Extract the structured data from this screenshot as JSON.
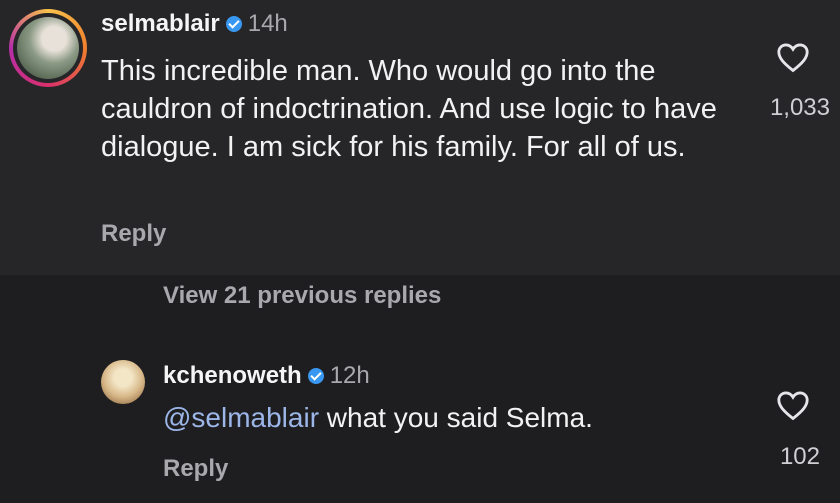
{
  "comment": {
    "username": "selmablair",
    "time": "14h",
    "text": "This incredible man. Who would go into the cauldron of indoctrination. And use logic to have dialogue.  I am sick for his family. For all of us.",
    "reply_label": "Reply",
    "likes": "1,033"
  },
  "thread": {
    "view_replies_label": "View 21 previous replies"
  },
  "reply": {
    "username": "kchenoweth",
    "time": "12h",
    "mention": "@selmablair",
    "text": " what you said Selma.",
    "reply_label": "Reply",
    "likes": "102"
  },
  "icons": {
    "verified": "verified-badge-icon",
    "like": "heart-outline-icon"
  },
  "colors": {
    "accent_blue": "#3897f0",
    "mention": "#9cb6e8",
    "secondary_text": "#a8a8ad"
  }
}
